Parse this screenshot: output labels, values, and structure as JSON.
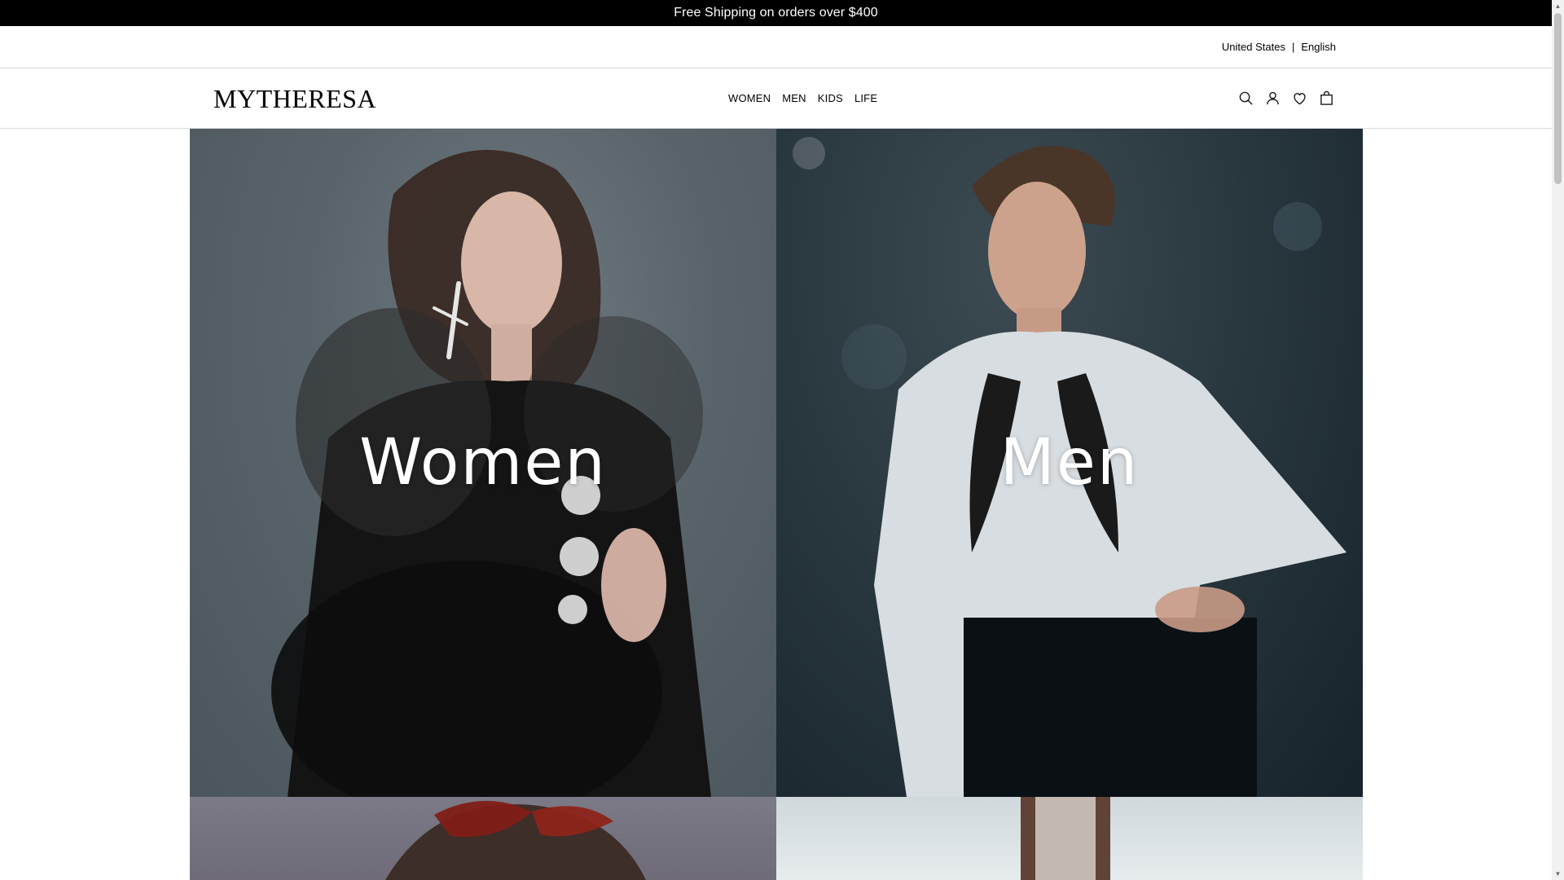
{
  "promo": {
    "text": "Free Shipping on orders over $400"
  },
  "utility": {
    "country": "United States",
    "separator": "|",
    "language": "English"
  },
  "header": {
    "logo": "MYTHERESA",
    "nav": [
      "WOMEN",
      "MEN",
      "KIDS",
      "LIFE"
    ],
    "icons": [
      "search-icon",
      "account-icon",
      "wishlist-heart-icon",
      "shopping-bag-icon"
    ]
  },
  "hero": {
    "tiles": [
      {
        "label": "Women"
      },
      {
        "label": "Men"
      }
    ]
  },
  "colors": {
    "promo_bg": "#000000",
    "promo_text": "#ffffff",
    "border": "#d9d9d9"
  }
}
